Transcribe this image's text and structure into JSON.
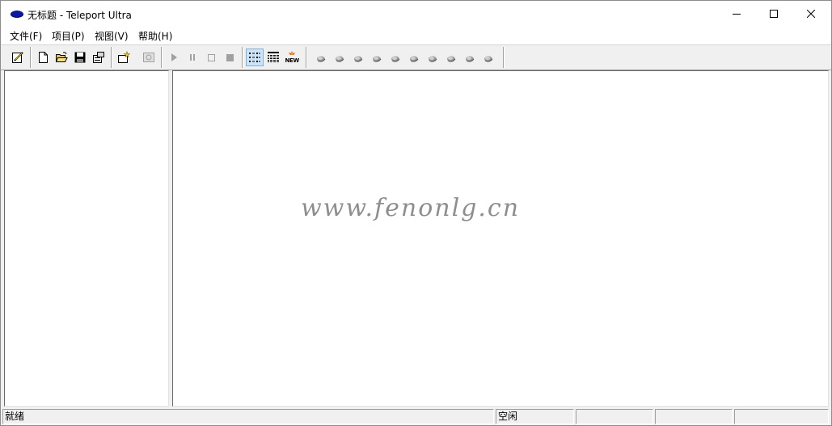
{
  "window": {
    "title": "无标题 - Teleport Ultra",
    "icon": "app-ellipse-icon",
    "controls": [
      "minimize-icon",
      "maximize-icon",
      "close-icon"
    ]
  },
  "menu": [
    {
      "id": "file",
      "label": "文件(F)"
    },
    {
      "id": "project",
      "label": "项目(P)"
    },
    {
      "id": "view",
      "label": "视图(V)"
    },
    {
      "id": "help",
      "label": "帮助(H)"
    }
  ],
  "toolbar": {
    "groups": [
      [
        "edit-icon"
      ],
      [
        "new-file-icon",
        "open-folder-icon",
        "save-icon",
        "properties-icon"
      ],
      [
        "new-address-icon",
        "find-icon"
      ],
      [
        "start-icon",
        "pause-icon",
        "stop-icon",
        "stop-all-icon"
      ],
      [
        "list-view-icon",
        "detail-view-icon",
        "new-badge-icon"
      ],
      [
        "status-light-icon"
      ]
    ],
    "status_light_count": 10
  },
  "watermark": "www.fenonlg.cn",
  "statusbar": {
    "ready": "就绪",
    "state": "空闲"
  },
  "colors": {
    "app_icon": "#0a1aa8",
    "toolbar_bg": "#f0f0f0",
    "active_button": "#cce4f7"
  }
}
